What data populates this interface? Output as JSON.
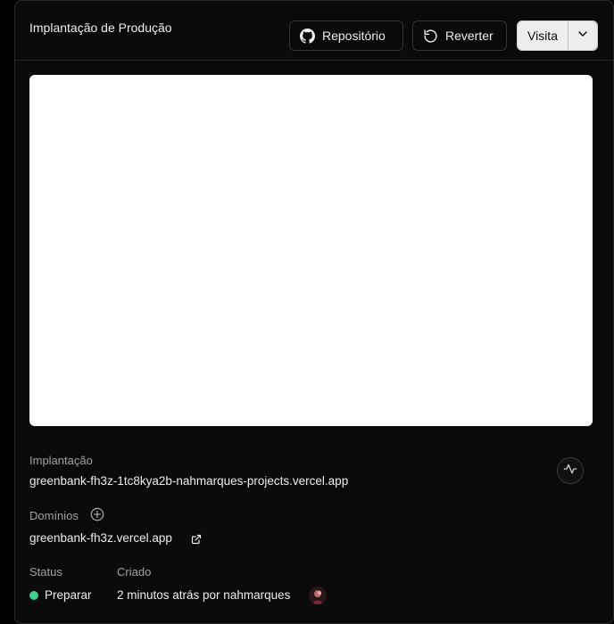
{
  "header": {
    "title": "Implantação de Produção",
    "repo_label": "Repositório",
    "revert_label": "Reverter",
    "visit_label": "Visita"
  },
  "deployment": {
    "label": "Implantação",
    "url": "greenbank-fh3z-1tc8kya2b-nahmarques-projects.vercel.app"
  },
  "domains": {
    "label": "Domínios",
    "url": "greenbank-fh3z.vercel.app"
  },
  "status": {
    "label": "Status",
    "value": "Preparar",
    "color": "#3ecf8e"
  },
  "created": {
    "label": "Criado",
    "value": "2 minutos atrás por nahmarques"
  },
  "icons": [
    "github-icon",
    "revert-icon",
    "chevron-down-icon",
    "activity-icon",
    "plus-circle-icon",
    "external-link-icon",
    "avatar"
  ]
}
